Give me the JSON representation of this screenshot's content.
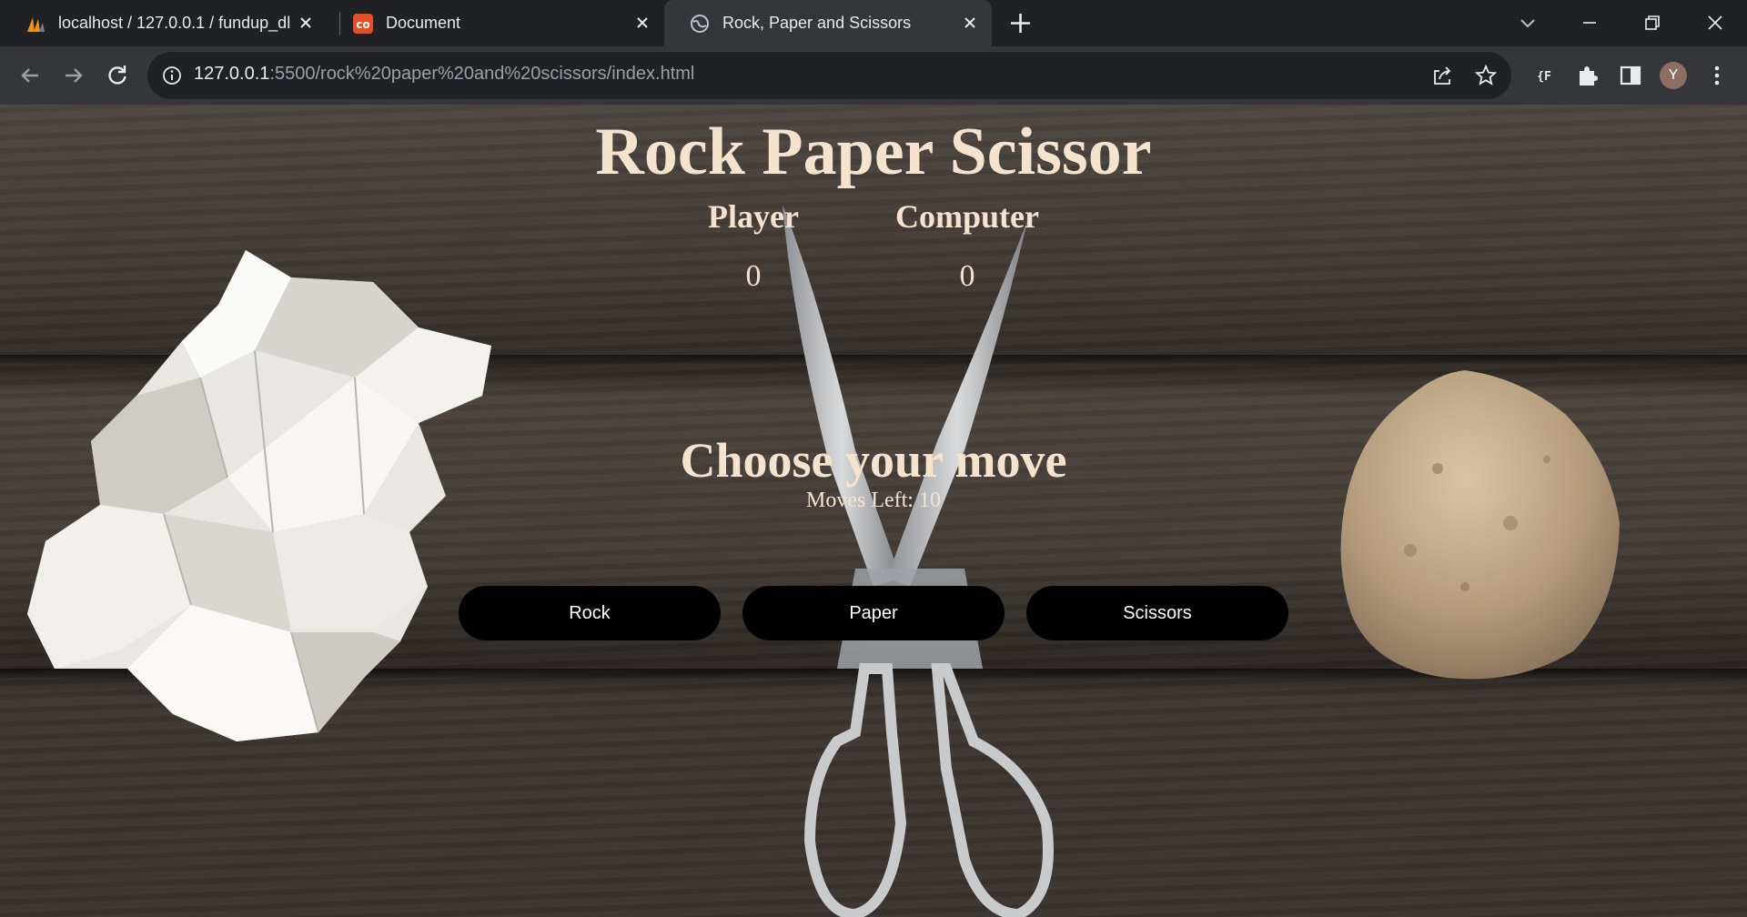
{
  "browser": {
    "tabs": [
      {
        "title": "localhost / 127.0.0.1 / fundup_dl",
        "favicon": "phpmyadmin-icon"
      },
      {
        "title": "Document",
        "favicon": "html5-icon"
      },
      {
        "title": "Rock, Paper and Scissors",
        "favicon": "globe-icon",
        "active": true
      }
    ],
    "url_host": "127.0.0.1",
    "url_rest": ":5500/rock%20paper%20and%20scissors/index.html",
    "profile_initial": "Y"
  },
  "game": {
    "title": "Rock Paper Scissor",
    "player_label": "Player",
    "computer_label": "Computer",
    "player_score": "0",
    "computer_score": "0",
    "prompt": "Choose your move",
    "moves_left_label": "Moves Left: ",
    "moves_left": "10",
    "buttons": {
      "rock": "Rock",
      "paper": "Paper",
      "scissors": "Scissors"
    }
  },
  "colors": {
    "title_text": "#f6e3cd",
    "button_bg": "#000000",
    "button_text": "#ffffff",
    "chrome_bg": "#202124",
    "toolbar_bg": "#35363a"
  }
}
